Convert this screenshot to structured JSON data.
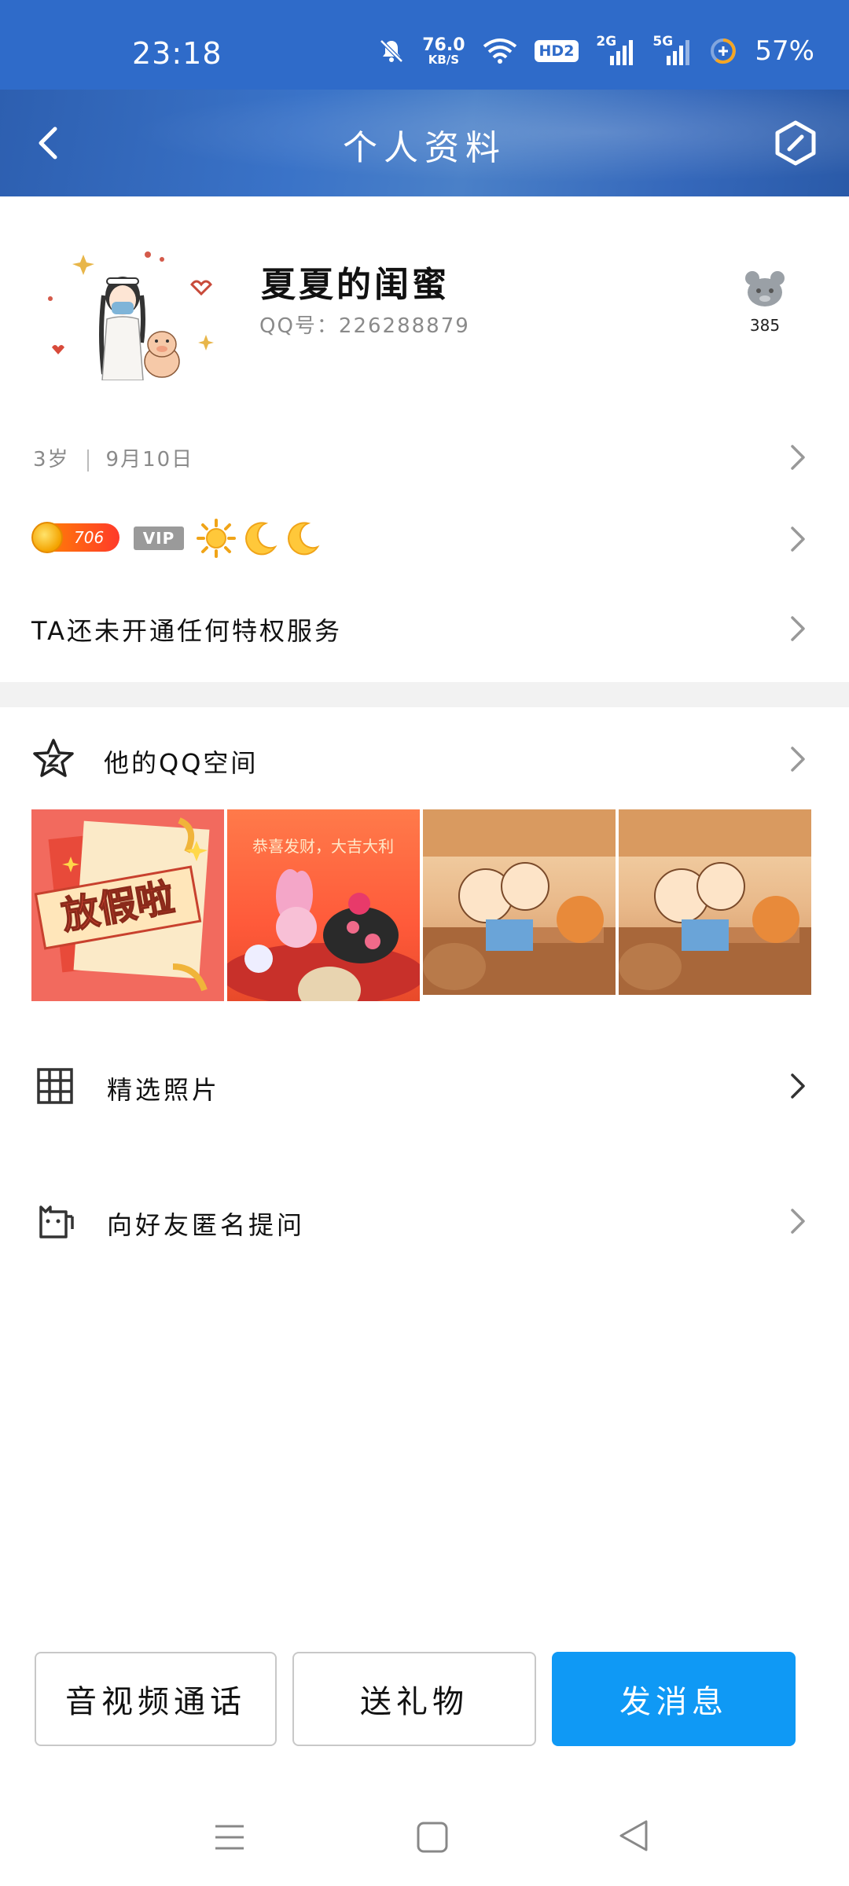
{
  "status_bar": {
    "time": "23:18",
    "net_speed_value": "76.0",
    "net_speed_unit": "KB/S",
    "hd_label": "HD2",
    "sim1_gen": "2G",
    "sim2_gen": "5G",
    "battery": "57%"
  },
  "header": {
    "title": "个人资料"
  },
  "profile": {
    "nickname": "夏夏的闺蜜",
    "qq_number": "QQ号：226288879",
    "likes_count": "385"
  },
  "info": {
    "age": "3岁",
    "birthday": "9月10日"
  },
  "badges": {
    "level": "706",
    "vip": "VIP",
    "icons": [
      "sun-icon",
      "moon-icon",
      "moon-icon"
    ]
  },
  "privilege_text": "TA还未开通任何特权服务",
  "qzone": {
    "label": "他的QQ空间",
    "thumbnails": [
      {
        "caption": "放假啦"
      },
      {
        "caption": "恭喜发财，大吉大利"
      },
      {
        "caption": ""
      },
      {
        "caption": ""
      }
    ]
  },
  "photos_label": "精选照片",
  "ask_label": "向好友匿名提问",
  "buttons": {
    "call": "音视频通话",
    "gift": "送礼物",
    "message": "发消息"
  },
  "colors": {
    "status_bar": "#2f6bc9",
    "primary_button": "#0f99f5",
    "divider": "#f2f2f2"
  }
}
